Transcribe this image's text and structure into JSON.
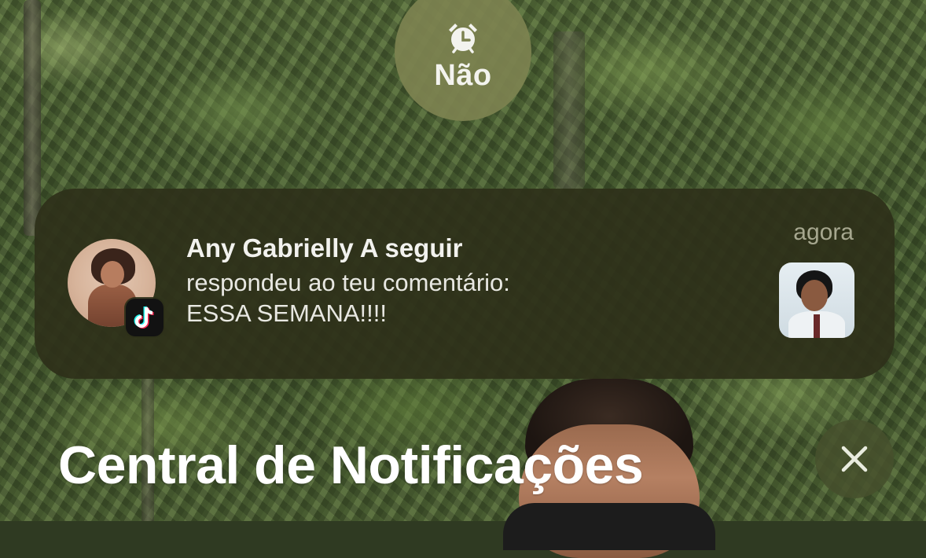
{
  "focus": {
    "label": "Não",
    "icon": "alarm-clock-icon"
  },
  "notification": {
    "title": "Any Gabrielly A seguir",
    "body_line1": "respondeu ao teu comentário:",
    "body_line2": "ESSA SEMANA!!!!",
    "time": "agora",
    "app_icon": "tiktok-icon"
  },
  "header": {
    "title": "Central de Notificações",
    "close_icon": "close-icon"
  }
}
